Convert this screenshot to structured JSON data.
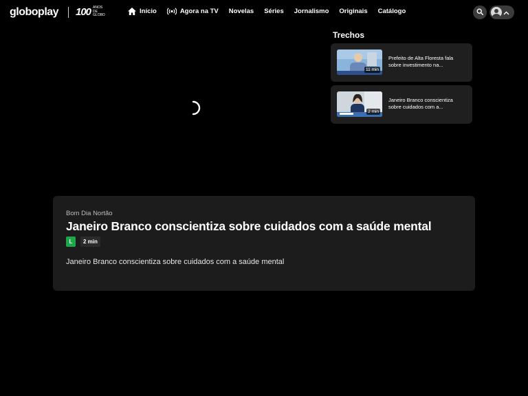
{
  "header": {
    "logo": "globoplay",
    "badge_number": "100",
    "badge_text": "anos de globo",
    "nav": [
      {
        "label": "Início",
        "icon": "home-icon"
      },
      {
        "label": "Agora na TV",
        "icon": "live-broadcast-icon"
      },
      {
        "label": "Novelas"
      },
      {
        "label": "Séries"
      },
      {
        "label": "Jornalismo"
      },
      {
        "label": "Originais"
      },
      {
        "label": "Catálogo"
      }
    ]
  },
  "sidebar": {
    "title": "Trechos",
    "clips": [
      {
        "title": "Prefeito de Alta Floresta fala sobre investimento na...",
        "duration": "11 min"
      },
      {
        "title": "Janeiro Branco conscientiza sobre cuidados com a...",
        "duration": "2 min"
      }
    ]
  },
  "video": {
    "program": "Bom Dia Nortão",
    "title": "Janeiro Branco conscientiza sobre cuidados com a saúde mental",
    "rating": "L",
    "duration": "2 min",
    "description": "Janeiro Branco conscientiza sobre cuidados com a saúde mental"
  },
  "colors": {
    "background": "#000000",
    "card": "#1c1c1c",
    "rating_green": "#1ea64a"
  }
}
